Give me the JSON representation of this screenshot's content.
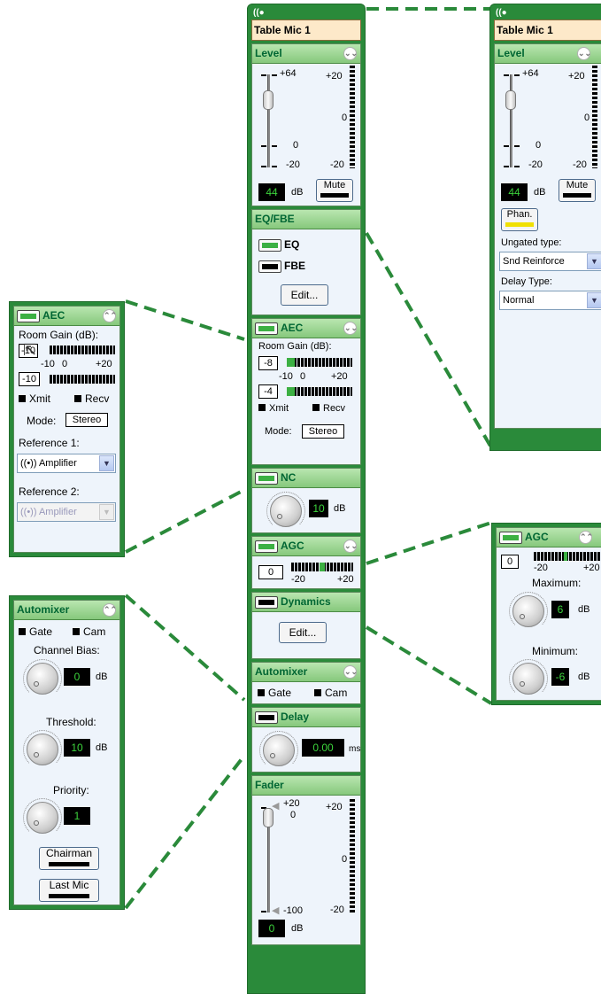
{
  "channel": {
    "name": "Table Mic 1"
  },
  "level": {
    "title": "Level",
    "scale": {
      "top": "+64",
      "mid": "0",
      "bottom": "-20"
    },
    "meter": {
      "top": "+20",
      "mid": "0",
      "bottom": "-20"
    },
    "value": "44",
    "unit": "dB",
    "mute_label": "Mute"
  },
  "eqfbe": {
    "title": "EQ/FBE",
    "eq_label": "EQ",
    "fbe_label": "FBE",
    "edit_label": "Edit..."
  },
  "aec": {
    "title": "AEC",
    "room_gain_label": "Room Gain (dB):",
    "gain1": "-8",
    "gain2": "-4",
    "scale_left": "-10",
    "scale_mid": "0",
    "scale_right": "+20",
    "xmit": "Xmit",
    "recv": "Recv",
    "mode_label": "Mode:",
    "mode_value": "Stereo"
  },
  "aec_expanded": {
    "title": "AEC",
    "room_gain_label": "Room Gain (dB):",
    "gain1": "-10",
    "gain2": "-10",
    "scale_left": "-10",
    "scale_mid": "0",
    "scale_right": "+20",
    "xmit": "Xmit",
    "recv": "Recv",
    "mode_label": "Mode:",
    "mode_value": "Stereo",
    "ref1_label": "Reference 1:",
    "ref1_value": "((•)) Amplifier",
    "ref2_label": "Reference 2:",
    "ref2_value": "((•)) Amplifier"
  },
  "nc": {
    "title": "NC",
    "value": "10",
    "unit": "dB"
  },
  "agc": {
    "title": "AGC",
    "value": "0",
    "scale_left": "-20",
    "scale_right": "+20"
  },
  "agc_expanded": {
    "title": "AGC",
    "value": "0",
    "scale_left": "-20",
    "scale_right": "+20",
    "max_label": "Maximum:",
    "max_value": "6",
    "min_label": "Minimum:",
    "min_value": "-6",
    "unit": "dB"
  },
  "dynamics": {
    "title": "Dynamics",
    "edit_label": "Edit..."
  },
  "automixer": {
    "title": "Automixer",
    "gate": "Gate",
    "cam": "Cam"
  },
  "automixer_expanded": {
    "title": "Automixer",
    "gate": "Gate",
    "cam": "Cam",
    "bias_label": "Channel Bias:",
    "bias_value": "0",
    "threshold_label": "Threshold:",
    "threshold_value": "10",
    "priority_label": "Priority:",
    "priority_value": "1",
    "unit": "dB",
    "chairman_label": "Chairman",
    "lastmic_label": "Last Mic"
  },
  "delay": {
    "title": "Delay",
    "value": "0.00",
    "unit": "ms"
  },
  "fader": {
    "title": "Fader",
    "scale": {
      "top": "+20",
      "mid": "0",
      "bottom": "-100"
    },
    "meter": {
      "top": "+20",
      "mid": "0",
      "bottom": "-20"
    },
    "value": "0",
    "unit": "dB"
  },
  "right_panel": {
    "channel_name": "Table Mic 1",
    "level_title": "Level",
    "scale": {
      "top": "+64",
      "mid": "0",
      "bottom": "-20"
    },
    "meter": {
      "top": "+20",
      "mid": "0",
      "bottom": "-20"
    },
    "value": "44",
    "unit": "dB",
    "mute_label": "Mute",
    "phan_label": "Phan.",
    "ungated_label": "Ungated type:",
    "ungated_value": "Snd Reinforce",
    "delay_type_label": "Delay Type:",
    "delay_type_value": "Normal"
  },
  "colors": {
    "accent": "#2a8a3a",
    "header": "#9ad78f",
    "meter_on": "#3cb043",
    "connector": "#2a8a3a"
  },
  "icons": {
    "collapse": "chevron-double-down-icon",
    "expand": "chevron-double-up-icon",
    "channel": "broadcast-icon"
  }
}
